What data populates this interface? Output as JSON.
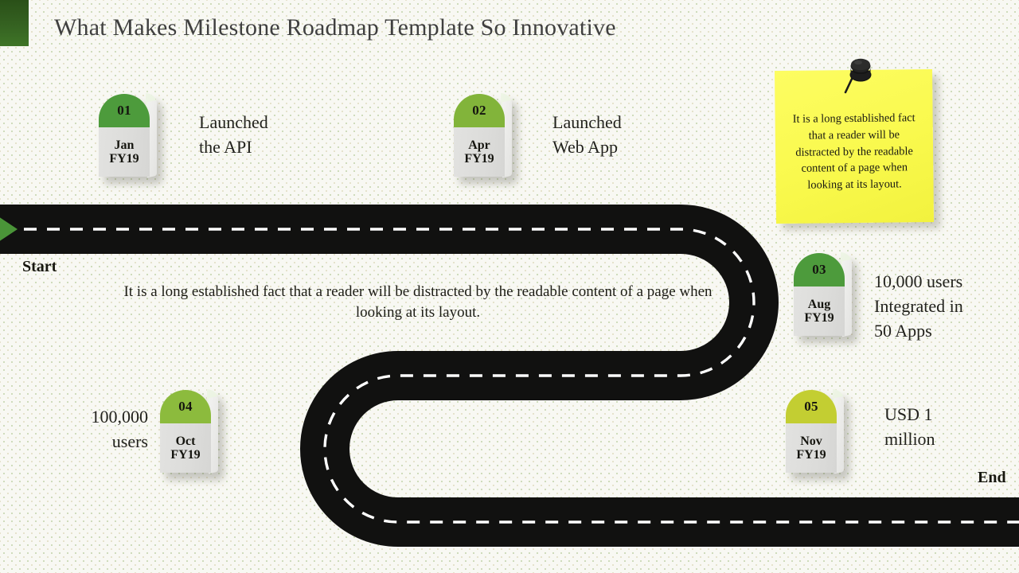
{
  "header": {
    "title": "What Makes Milestone Roadmap Template So Innovative",
    "accent_color": "#2a5018"
  },
  "road": {
    "start_label": "Start",
    "end_label": "End",
    "color": "#111110",
    "lane_marking_color": "#ffffff",
    "start_arrow_color": "#4a9438"
  },
  "center_paragraph": "It is a long established fact that a reader will be distracted by the readable content of a page when looking at its layout.",
  "sticky_note": {
    "text": "It is a long established fact that  a reader will be distracted by the readable content of a page when looking at its layout.",
    "color": "#fafa4f",
    "pin_color": "#141414"
  },
  "milestones": [
    {
      "number": "01",
      "month": "Jan",
      "year": "FY19",
      "label": "Launched\nthe API",
      "cap_color": "#4d9b3c",
      "label_side": "right"
    },
    {
      "number": "02",
      "month": "Apr",
      "year": "FY19",
      "label": "Launched\nWeb App",
      "cap_color": "#82b43a",
      "label_side": "right"
    },
    {
      "number": "03",
      "month": "Aug",
      "year": "FY19",
      "label": "10,000 users\nIntegrated in\n50 Apps",
      "cap_color": "#4d9b3c",
      "label_side": "right"
    },
    {
      "number": "04",
      "month": "Oct",
      "year": "FY19",
      "label": "100,000\nusers",
      "cap_color": "#8cbb3d",
      "label_side": "left"
    },
    {
      "number": "05",
      "month": "Nov",
      "year": "FY19",
      "label": "USD 1\nmillion",
      "cap_color": "#c3ce32",
      "label_side": "right"
    }
  ]
}
